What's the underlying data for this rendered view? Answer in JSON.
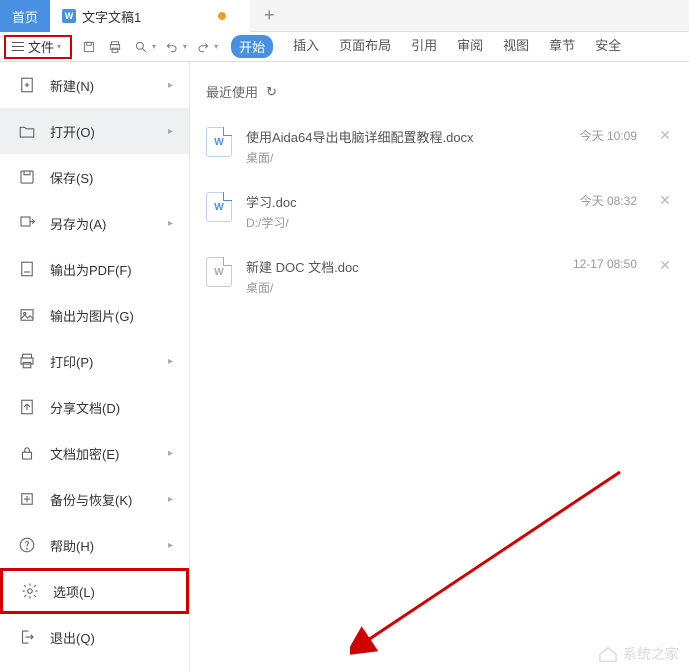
{
  "tabs": {
    "home": "首页",
    "doc": "文字文稿1",
    "doc_icon": "W"
  },
  "file_menu": {
    "label": "文件"
  },
  "ribbon": {
    "start": "开始",
    "insert": "插入",
    "layout": "页面布局",
    "ref": "引用",
    "review": "审阅",
    "view": "视图",
    "chapter": "章节",
    "security": "安全"
  },
  "sidebar": {
    "new": "新建(N)",
    "open": "打开(O)",
    "save": "保存(S)",
    "saveas": "另存为(A)",
    "exportpdf": "输出为PDF(F)",
    "exportimg": "输出为图片(G)",
    "print": "打印(P)",
    "share": "分享文档(D)",
    "encrypt": "文档加密(E)",
    "backup": "备份与恢复(K)",
    "help": "帮助(H)",
    "options": "选项(L)",
    "exit": "退出(Q)"
  },
  "recent": {
    "title": "最近使用",
    "files": [
      {
        "name": "使用Aida64导出电脑详细配置教程.docx",
        "path": "桌面/",
        "time": "今天 10:09",
        "gray": false
      },
      {
        "name": "学习.doc",
        "path": "D:/学习/",
        "time": "今天 08:32",
        "gray": false
      },
      {
        "name": "新建 DOC 文档.doc",
        "path": "桌面/",
        "time": "12-17 08:50",
        "gray": true
      }
    ]
  },
  "watermark": "系统之家"
}
